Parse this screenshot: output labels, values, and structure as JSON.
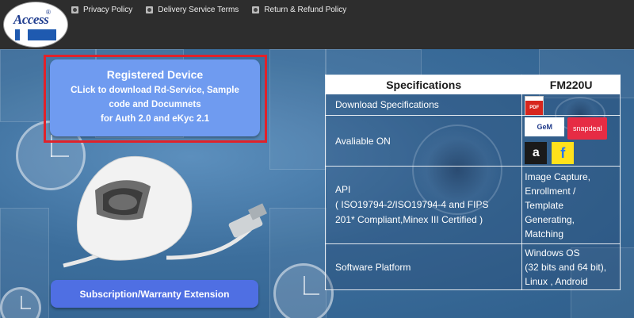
{
  "logo": {
    "text": "Access",
    "mark": "®"
  },
  "nav": [
    {
      "label": "Privacy Policy",
      "icon": "document-icon"
    },
    {
      "label": "Delivery Service Terms",
      "icon": "document-icon"
    },
    {
      "label": "Return & Refund Policy",
      "icon": "document-icon"
    }
  ],
  "registered": {
    "title": "Registered Device",
    "line1": "CLick to download Rd-Service, Sample",
    "line2": "code and Documnets",
    "line3": "for Auth 2.0 and eKyc 2.1"
  },
  "subscription": {
    "label": "Subscription/Warranty Extension"
  },
  "spec": {
    "head_left": "Specifications",
    "head_right": "FM220U",
    "rows": {
      "download": "Download Specifications",
      "available": "Avaliable ON",
      "api_label": "API",
      "api_desc1": "( ISO19794-2/ISO19794-4 and FIPS",
      "api_desc2": "201* Compliant,Minex III Certified )",
      "api_value": [
        "Image Capture,",
        "Enrollment /",
        "Template",
        "Generating,",
        "Matching"
      ],
      "platform_label": "Software Platform",
      "platform_value": [
        "Windows OS",
        "(32 bits and 64 bit),",
        "Linux , Android"
      ]
    },
    "stores": {
      "gem": "GeM",
      "snapdeal": "snapdeal",
      "amazon": "a",
      "flipkart": "f"
    }
  },
  "colors": {
    "header": "#2d2d2d",
    "reg_button": "#6f9bf0",
    "highlight": "#e0222a",
    "sub_button": "#4f6fe3"
  }
}
